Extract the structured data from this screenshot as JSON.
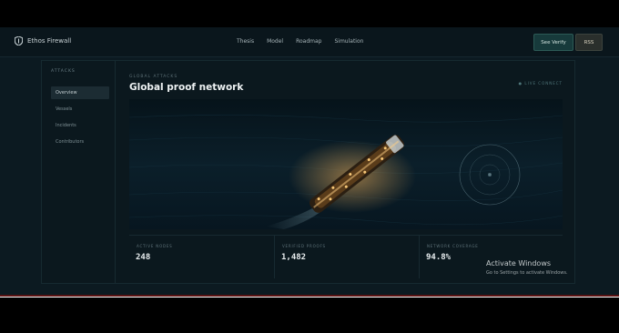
{
  "header": {
    "brand": "Ethos Firewall",
    "nav": [
      "Thesis",
      "Model",
      "Roadmap",
      "Simulation"
    ],
    "verify_button": "See Verify",
    "rss_button": "RSS"
  },
  "sidebar": {
    "title": "ATTACKS",
    "items": [
      {
        "label": "Overview",
        "active": true
      },
      {
        "label": "Vessels",
        "active": false
      },
      {
        "label": "Incidents",
        "active": false
      },
      {
        "label": "Contributors",
        "active": false
      }
    ]
  },
  "main": {
    "eyebrow": "GLOBAL ATTACKS",
    "title": "Global proof network",
    "status": "● LIVE CONNECT"
  },
  "stats": [
    {
      "label": "ACTIVE NODES",
      "value": "248"
    },
    {
      "label": "VERIFIED PROOFS",
      "value": "1,482"
    },
    {
      "label": "NETWORK COVERAGE",
      "value": "94.8%"
    }
  ],
  "watermark": {
    "title": "Activate Windows",
    "subtitle": "Go to Settings to activate Windows."
  },
  "colors": {
    "background": "#0c1a21",
    "accent": "#2c5a55",
    "ship_lights": "#f5b35a"
  }
}
